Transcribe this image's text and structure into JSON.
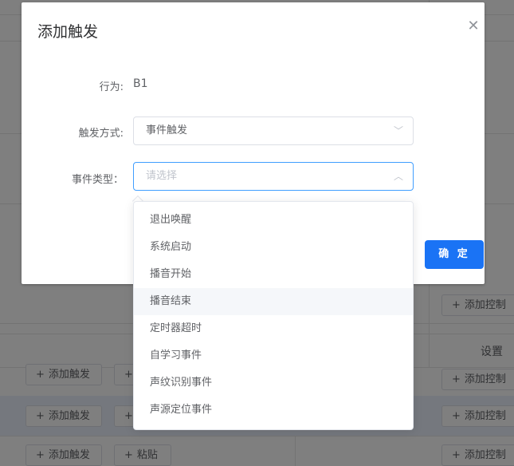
{
  "background": {
    "header_setting": "设置",
    "add_trigger_label": "添加触发",
    "paste_label": "粘贴",
    "add_control_label": "添加控制"
  },
  "dialog": {
    "title": "添加触发",
    "close_icon": "close-icon",
    "behavior_label": "行为:",
    "behavior_value": "B1",
    "trigger_mode_label": "触发方式:",
    "trigger_mode_value": "事件触发",
    "event_type_label": "事件类型：",
    "event_type_placeholder": "请选择",
    "confirm_label": "确 定"
  },
  "dropdown": {
    "items": [
      "退出唤醒",
      "系统启动",
      "播音开始",
      "播音结束",
      "定时器超时",
      "自学习事件",
      "声纹识别事件",
      "声源定位事件"
    ],
    "hovered_index": 3
  },
  "colors": {
    "primary": "#1a73f5",
    "focus_border": "#409eff"
  }
}
